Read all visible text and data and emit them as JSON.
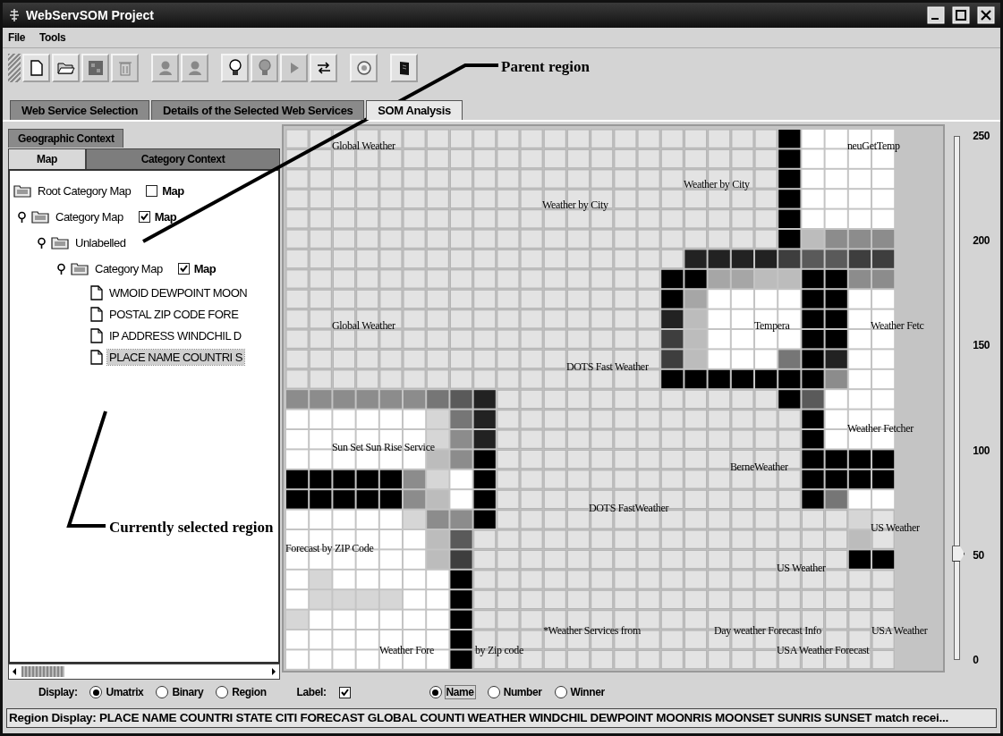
{
  "window": {
    "title": "WebServSOM Project"
  },
  "menu": [
    "File",
    "Tools"
  ],
  "toolbar": [
    {
      "disabled": false
    },
    {
      "disabled": false
    },
    {
      "disabled": true
    },
    {
      "disabled": true
    },
    {
      "disabled": true
    },
    {
      "disabled": true
    },
    {
      "disabled": false
    },
    {
      "disabled": true
    },
    {
      "disabled": true
    },
    {
      "disabled": false
    },
    {
      "disabled": false
    },
    {
      "disabled": false
    }
  ],
  "tabs": [
    {
      "label": "Web Service Selection",
      "selected": false
    },
    {
      "label": "Details of the Selected Web Services",
      "selected": false
    },
    {
      "label": "SOM Analysis",
      "selected": true
    }
  ],
  "left_panel": {
    "context_tab": {
      "label": "Geographic Context",
      "selected": true
    },
    "tabs": [
      {
        "label": "Map",
        "selected": true
      },
      {
        "label": "Category Context",
        "selected": false
      }
    ],
    "tree": {
      "label": "Root Category Map",
      "kind": "category",
      "map_label": "Map",
      "map_checked": false,
      "children": [
        {
          "label": "Category Map",
          "kind": "category",
          "expanded": true,
          "map_label": "Map",
          "map_checked": true,
          "children": [
            {
              "label": "Unlabelled",
              "kind": "category",
              "expanded": true,
              "children": [
                {
                  "label": "Category Map",
                  "kind": "category",
                  "expanded": true,
                  "map_label": "Map",
                  "map_checked": true,
                  "children": [
                    {
                      "label": "WMOID DEWPOINT MOON",
                      "kind": "document",
                      "selected": false
                    },
                    {
                      "label": "POSTAL ZIP CODE FORE",
                      "kind": "document",
                      "selected": false
                    },
                    {
                      "label": "IP ADDRESS WINDCHIL D",
                      "kind": "document",
                      "selected": false
                    },
                    {
                      "label": "PLACE NAME COUNTRI S",
                      "kind": "document",
                      "selected": true
                    }
                  ]
                }
              ]
            }
          ]
        }
      ]
    }
  },
  "map": {
    "labels": [
      "Global Weather",
      "neuGetTemp",
      "Weather by City",
      "Weather by City",
      "Global Weather",
      "Tempera",
      "Weather Fetc",
      "DOTS Fast Weather",
      "Weather Fetcher",
      "Sun Set Sun Rise Service",
      "BerneWeather",
      "DOTS FastWeather",
      "US Weather",
      "Forecast by ZIP Code",
      "US Weather",
      "*Weather Services from",
      "Day weather Forecast Info",
      "USA Weather",
      "Weather Fore",
      "by Zip code",
      "USA Weather Forecast"
    ]
  },
  "scale": {
    "ticks": [
      "250",
      "200",
      "150",
      "100",
      "50",
      "0"
    ],
    "level": 0.2
  },
  "annotations": [
    {
      "label": "Parent region"
    },
    {
      "label": "Currently selected region"
    }
  ],
  "controls": {
    "display_label": "Display:",
    "display_options": [
      {
        "label": "Umatrix",
        "selected": true
      },
      {
        "label": "Binary",
        "selected": false
      },
      {
        "label": "Region",
        "selected": false
      }
    ],
    "label_label": "Label:",
    "label_checked": true,
    "label_options": [
      {
        "label": "Name",
        "selected": true
      },
      {
        "label": "Number",
        "selected": false
      },
      {
        "label": "Winner",
        "selected": false
      }
    ]
  },
  "status_bar": "Region Display:  PLACE NAME COUNTRI STATE CITI FORECAST GLOBAL COUNTI WEATHER WINDCHIL DEWPOINT MOONRIS MOONSET SUNRIS SUNSET match recei..."
}
